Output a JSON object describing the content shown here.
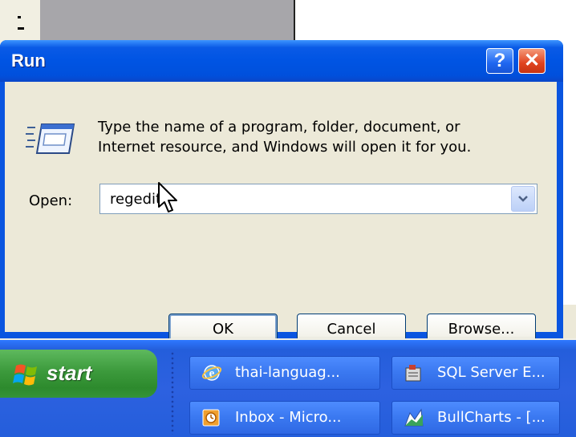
{
  "dialog": {
    "title": "Run",
    "help_label": "?",
    "close_label": "✕",
    "description_line1": "Type the name of a program, folder, document, or",
    "description_line2": "Internet resource, and Windows will open it for you.",
    "open_label": "Open:",
    "open_value": "regedit",
    "ok_label": "OK",
    "cancel_label": "Cancel",
    "browse_label": "Browse..."
  },
  "taskbar": {
    "start_label": "start",
    "tasks": [
      {
        "label": "thai-languag...",
        "icon": "internet-explorer-icon"
      },
      {
        "label": "SQL Server E...",
        "icon": "sql-server-icon"
      },
      {
        "label": "Inbox - Micro...",
        "icon": "outlook-icon"
      },
      {
        "label": "BullCharts - [...",
        "icon": "bullcharts-icon"
      }
    ]
  },
  "colors": {
    "title_bar": "#0054e3",
    "dialog_body": "#ece9d8",
    "start_button": "#3c9a3c",
    "taskbar": "#245edb"
  }
}
